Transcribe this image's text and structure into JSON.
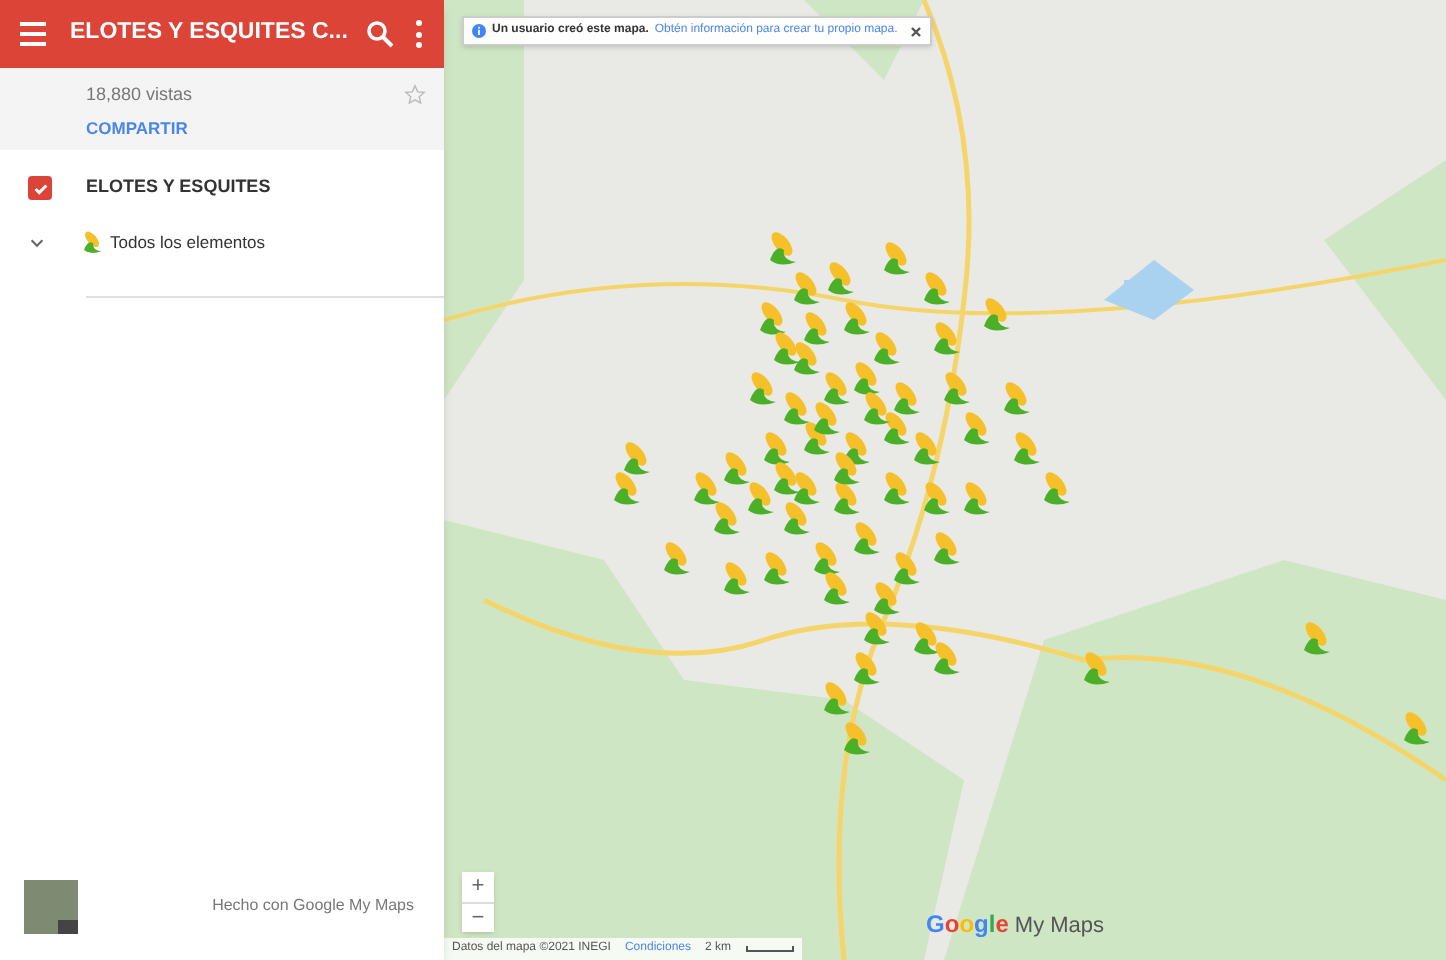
{
  "header": {
    "title": "ELOTES Y ESQUITES C..."
  },
  "info": {
    "views": "18,880 vistas",
    "share": "COMPARTIR",
    "starred": false
  },
  "layer": {
    "name": "ELOTES Y ESQUITES",
    "checked": true,
    "expanded": true,
    "items": [
      {
        "label": "Todos los elementos"
      }
    ]
  },
  "footer": {
    "text": "Hecho con Google My Maps"
  },
  "map": {
    "banner": {
      "text": "Un usuario creó este mapa.",
      "link": "Obtén información para crear tu propio mapa."
    },
    "zoom_buttons": [
      "+",
      "−"
    ],
    "attribution": {
      "data": "Datos del mapa ©2021 INEGI",
      "terms": "Condiciones",
      "scale": "2 km"
    },
    "logo": {
      "google": "Google",
      "product": "My Maps"
    }
  }
}
